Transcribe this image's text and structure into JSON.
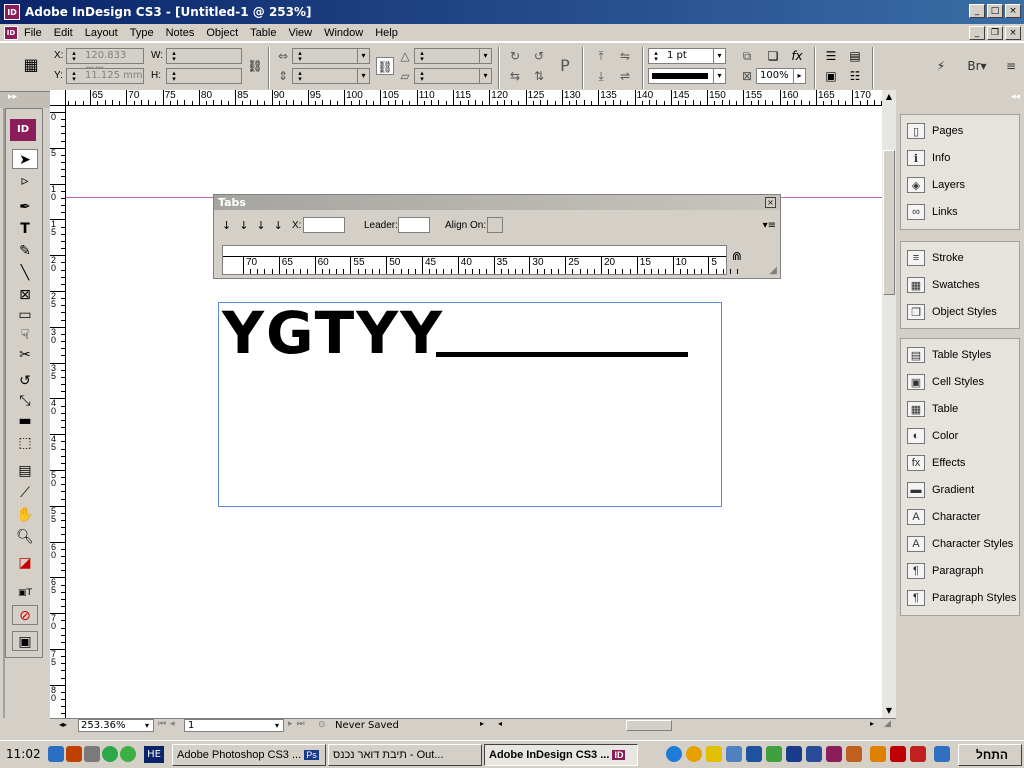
{
  "window": {
    "title": "Adobe InDesign CS3 - [Untitled-1 @ 253%]",
    "app_icon": "ID"
  },
  "menu": [
    "File",
    "Edit",
    "Layout",
    "Type",
    "Notes",
    "Object",
    "Table",
    "View",
    "Window",
    "Help"
  ],
  "control": {
    "x_label": "X:",
    "x_value": "120.833 mm",
    "y_label": "Y:",
    "y_value": "11.125 mm",
    "w_label": "W:",
    "h_label": "H:",
    "stroke_weight": "1 pt",
    "zoom_percent": "100%"
  },
  "tabs_panel": {
    "title": "Tabs",
    "x_label": "X:",
    "leader_label": "Leader:",
    "align_label": "Align On:",
    "ruler_numbers": [
      "70",
      "65",
      "60",
      "55",
      "50",
      "45",
      "40",
      "35",
      "30",
      "25",
      "20",
      "15",
      "10",
      "5"
    ]
  },
  "document": {
    "text": "YGTYY",
    "hruler": [
      "65",
      "70",
      "75",
      "80",
      "85",
      "90",
      "95",
      "100",
      "105",
      "110",
      "115",
      "120",
      "125",
      "130",
      "135",
      "140",
      "145",
      "150",
      "155",
      "160",
      "165",
      "170"
    ],
    "vruler": [
      "0",
      "5",
      "1\n0",
      "1\n5",
      "2\n0",
      "2\n5",
      "3\n0",
      "3\n5",
      "4\n0",
      "4\n5",
      "5\n0",
      "5\n5",
      "6\n0",
      "6\n5",
      "7\n0",
      "7\n5",
      "8\n0"
    ]
  },
  "statusbar": {
    "zoom": "253.36%",
    "page": "1",
    "save_status": "Never Saved"
  },
  "panels": {
    "group1": [
      {
        "label": "Pages",
        "icon": "pages-icon"
      },
      {
        "label": "Info",
        "icon": "info-icon"
      },
      {
        "label": "Layers",
        "icon": "layers-icon"
      },
      {
        "label": "Links",
        "icon": "links-icon"
      }
    ],
    "group2": [
      {
        "label": "Stroke",
        "icon": "stroke-icon"
      },
      {
        "label": "Swatches",
        "icon": "swatches-icon"
      },
      {
        "label": "Object Styles",
        "icon": "object-styles-icon"
      }
    ],
    "group3": [
      {
        "label": "Table Styles",
        "icon": "table-styles-icon"
      },
      {
        "label": "Cell Styles",
        "icon": "cell-styles-icon"
      },
      {
        "label": "Table",
        "icon": "table-icon"
      },
      {
        "label": "Color",
        "icon": "color-icon"
      },
      {
        "label": "Effects",
        "icon": "effects-icon"
      },
      {
        "label": "Gradient",
        "icon": "gradient-icon"
      },
      {
        "label": "Character",
        "icon": "character-icon"
      },
      {
        "label": "Character Styles",
        "icon": "character-styles-icon"
      },
      {
        "label": "Paragraph",
        "icon": "paragraph-icon"
      },
      {
        "label": "Paragraph Styles",
        "icon": "paragraph-styles-icon"
      }
    ]
  },
  "taskbar": {
    "clock": "11:02",
    "lang": "HE",
    "start": "התחל",
    "tasks": [
      "Adobe Photoshop CS3 ...",
      "תיבת דואר נכנס - Out...",
      "Adobe InDesign CS3 ..."
    ],
    "task_badges": [
      "Ps",
      "",
      "ID"
    ]
  }
}
